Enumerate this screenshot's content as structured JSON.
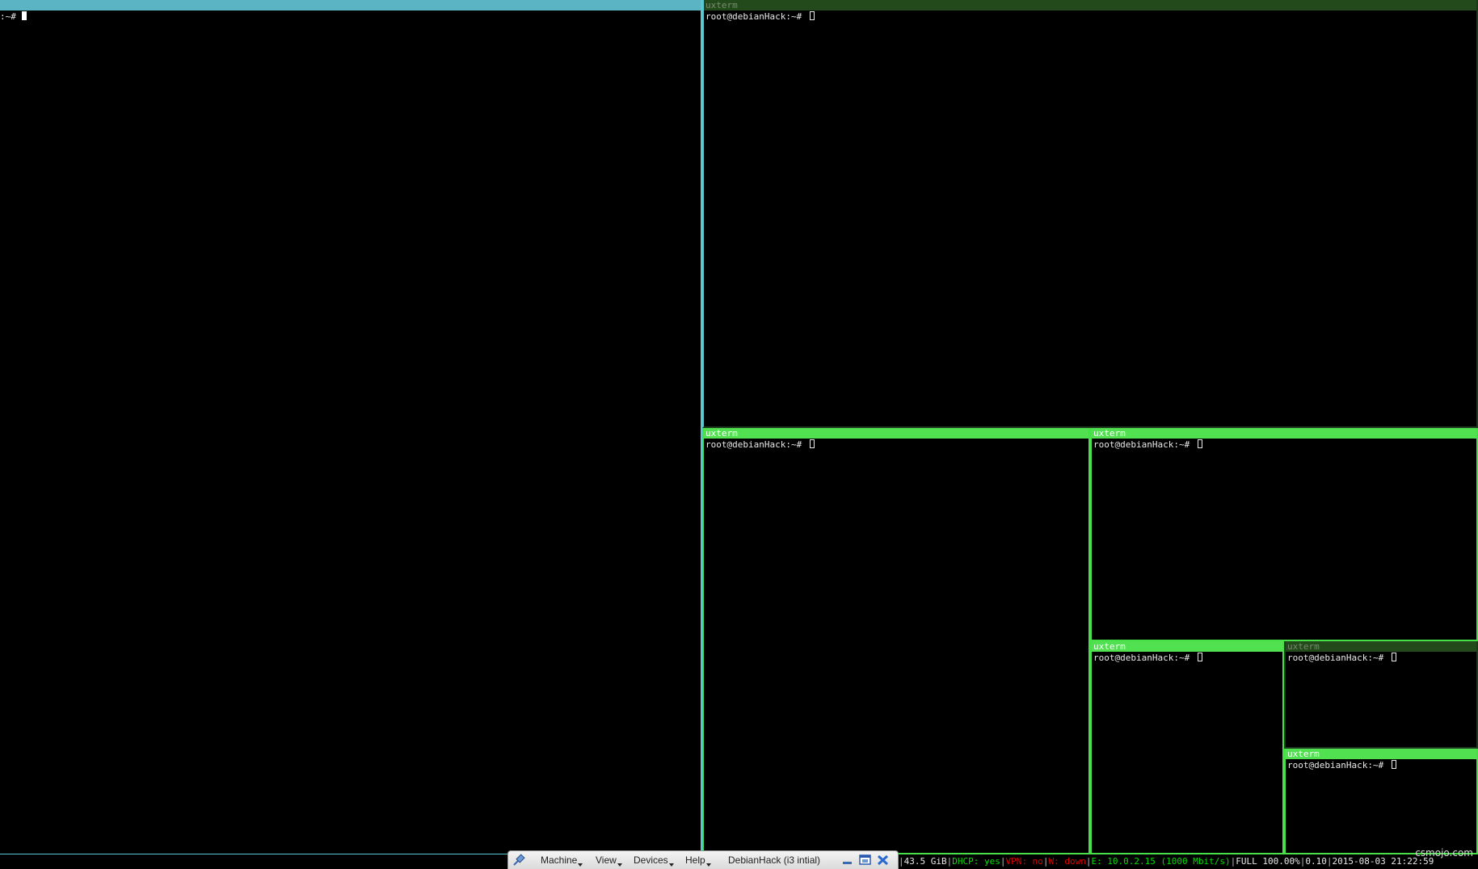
{
  "windows": {
    "left": {
      "prompt": ":~# "
    },
    "top_right": {
      "title": "uxterm",
      "prompt": "root@debianHack:~# "
    },
    "mid_left": {
      "title": "uxterm",
      "prompt": "root@debianHack:~# "
    },
    "mid_right": {
      "title": "uxterm",
      "prompt": "root@debianHack:~# "
    },
    "low_a": {
      "title": "uxterm",
      "prompt": "root@debianHack:~# "
    },
    "low_b": {
      "title": "uxterm",
      "prompt": "root@debianHack:~# "
    },
    "low_c": {
      "title": "uxterm",
      "prompt": "root@debianHack:~# "
    }
  },
  "vbox_toolbar": {
    "pin_icon": "pin-icon",
    "menus": [
      "Machine",
      "View",
      "Devices",
      "Help"
    ],
    "vm_title": "DebianHack (i3 intial)",
    "minimize_icon": "minimize-icon",
    "restore_icon": "restore-icon",
    "close_icon": "close-icon"
  },
  "status": {
    "disk": "43.5 GiB",
    "dhcp": "DHCP: yes",
    "vpn": "VPN: no",
    "wifi": "W: down",
    "ethernet": "E: 10.0.2.15 (1000 Mbit/s)",
    "battery": "FULL 100.00%",
    "load": "0.10",
    "datetime": "2015-08-03 21:22:59"
  },
  "watermark": "csmojo.com",
  "colors": {
    "focused_border": "#5ac8d0",
    "active_green": "#50e050",
    "inactive_title": "#234a1a",
    "status_green": "#00e000",
    "status_red": "#e00000",
    "background": "#000000"
  }
}
